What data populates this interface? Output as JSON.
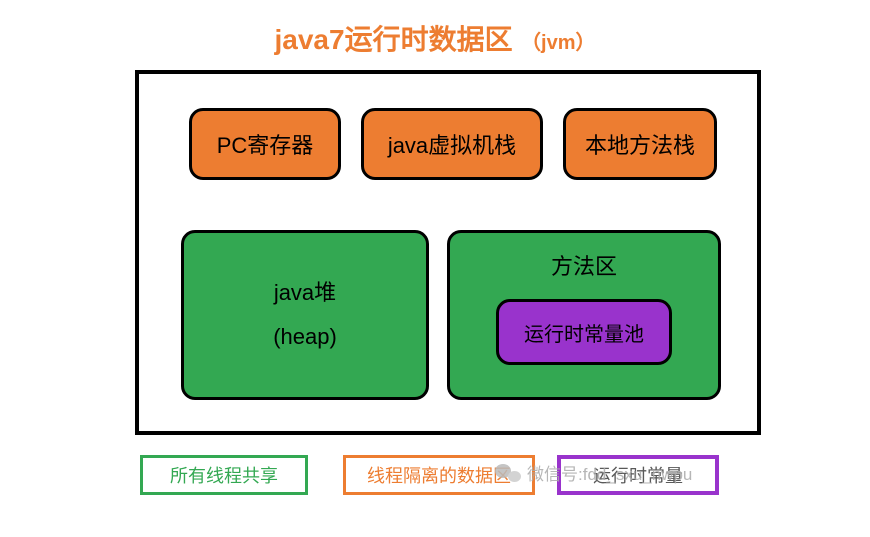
{
  "title": {
    "main": "java7运行时数据区",
    "sub": "（jvm）"
  },
  "thread_private": {
    "pc_register": "PC寄存器",
    "jvm_stack": "java虚拟机栈",
    "native_stack": "本地方法栈"
  },
  "thread_shared": {
    "heap_line1": "java堆",
    "heap_line2": "(heap)",
    "method_area": "方法区",
    "const_pool": "运行时常量池"
  },
  "legend": {
    "shared": "所有线程共享",
    "isolated": "线程隔离的数据区",
    "const": "运行时常量"
  },
  "watermark": {
    "label": "微信号",
    "value": "fdd_sxu_nwpu"
  }
}
